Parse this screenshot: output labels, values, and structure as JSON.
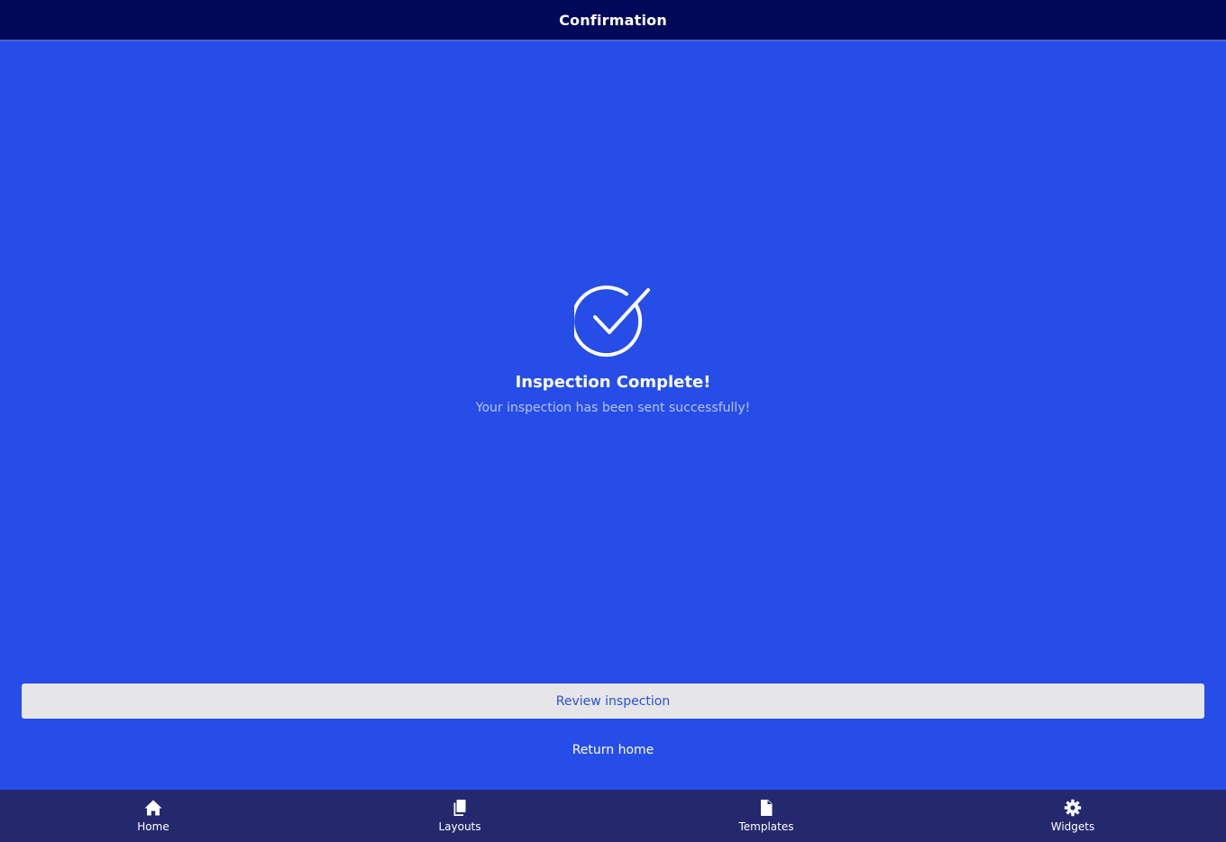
{
  "header": {
    "title": "Confirmation"
  },
  "success": {
    "icon": "check-circle-icon",
    "title": "Inspection Complete!",
    "subtitle": "Your inspection has been sent successfully!"
  },
  "actions": {
    "review_label": "Review inspection",
    "return_label": "Return home"
  },
  "tabbar": {
    "items": [
      {
        "label": "Home",
        "icon": "home-icon"
      },
      {
        "label": "Layouts",
        "icon": "layouts-icon"
      },
      {
        "label": "Templates",
        "icon": "document-icon"
      },
      {
        "label": "Widgets",
        "icon": "gear-icon"
      }
    ]
  },
  "colors": {
    "header_bg": "#000958",
    "page_bg": "#264de8",
    "tabbar_bg": "#24296e",
    "button_bg": "#e6e6e8",
    "button_text": "#2c4fd8",
    "subtitle_text": "#b8c4f4"
  }
}
